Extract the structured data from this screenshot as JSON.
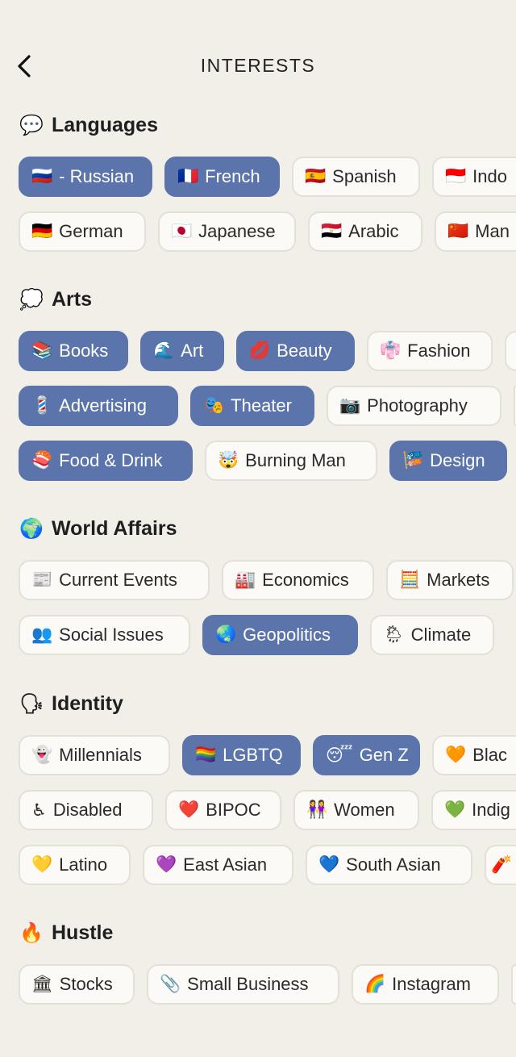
{
  "header": {
    "title": "INTERESTS",
    "back_icon": "chevron-left-icon"
  },
  "colors": {
    "background": "#f1efe8",
    "selected_chip": "#5b74ab",
    "unselected_chip": "#fbfaf6"
  },
  "sections": [
    {
      "emoji": "💬",
      "title": "Languages",
      "rows": [
        [
          {
            "emoji": "🇷🇺",
            "label": "- Russian",
            "selected": true
          },
          {
            "emoji": "🇫🇷",
            "label": "French",
            "selected": true
          },
          {
            "emoji": "🇪🇸",
            "label": "Spanish",
            "selected": false
          },
          {
            "emoji": "🇮🇩",
            "label": "Indo",
            "selected": false
          }
        ],
        [
          {
            "emoji": "🇩🇪",
            "label": "German",
            "selected": false
          },
          {
            "emoji": "🇯🇵",
            "label": "Japanese",
            "selected": false
          },
          {
            "emoji": "🇪🇬",
            "label": "Arabic",
            "selected": false
          },
          {
            "emoji": "🇨🇳",
            "label": "Man",
            "selected": false
          }
        ]
      ]
    },
    {
      "emoji": "💭",
      "title": "Arts",
      "rows": [
        [
          {
            "emoji": "📚",
            "label": "Books",
            "selected": true
          },
          {
            "emoji": "🌊",
            "label": "Art",
            "selected": true
          },
          {
            "emoji": "💋",
            "label": "Beauty",
            "selected": true
          },
          {
            "emoji": "👘",
            "label": "Fashion",
            "selected": false
          },
          {
            "emoji": "",
            "label": "",
            "selected": false
          }
        ],
        [
          {
            "emoji": "💈",
            "label": "Advertising",
            "selected": true
          },
          {
            "emoji": "🎭",
            "label": "Theater",
            "selected": true
          },
          {
            "emoji": "📷",
            "label": "Photography",
            "selected": false
          },
          {
            "emoji": "",
            "label": "",
            "selected": false
          }
        ],
        [
          {
            "emoji": "🍣",
            "label": "Food & Drink",
            "selected": true
          },
          {
            "emoji": "🤯",
            "label": "Burning Man",
            "selected": false
          },
          {
            "emoji": "🎏",
            "label": "Design",
            "selected": true
          }
        ]
      ]
    },
    {
      "emoji": "🌍",
      "title": "World Affairs",
      "rows": [
        [
          {
            "emoji": "📰",
            "label": "Current Events",
            "selected": false
          },
          {
            "emoji": "🏭",
            "label": "Economics",
            "selected": false
          },
          {
            "emoji": "🧮",
            "label": "Markets",
            "selected": false
          }
        ],
        [
          {
            "emoji": "👥",
            "label": "Social Issues",
            "selected": false
          },
          {
            "emoji": "🌏",
            "label": "Geopolitics",
            "selected": true
          },
          {
            "emoji": "🌦",
            "label": "Climate",
            "selected": false
          }
        ]
      ]
    },
    {
      "emoji": "🗣",
      "title": "Identity",
      "rows": [
        [
          {
            "emoji": "👻",
            "label": "Millennials",
            "selected": false
          },
          {
            "emoji": "🏳️‍🌈",
            "label": "LGBTQ",
            "selected": true
          },
          {
            "emoji": "😴",
            "label": "Gen Z",
            "selected": true
          },
          {
            "emoji": "🧡",
            "label": "Blac",
            "selected": false
          }
        ],
        [
          {
            "emoji": "♿",
            "label": "Disabled",
            "selected": false
          },
          {
            "emoji": "❤️",
            "label": "BIPOC",
            "selected": false
          },
          {
            "emoji": "👭",
            "label": "Women",
            "selected": false
          },
          {
            "emoji": "💚",
            "label": "Indig",
            "selected": false
          }
        ],
        [
          {
            "emoji": "💛",
            "label": "Latino",
            "selected": false
          },
          {
            "emoji": "💜",
            "label": "East Asian",
            "selected": false
          },
          {
            "emoji": "💙",
            "label": "South Asian",
            "selected": false
          },
          {
            "emoji": "🧨",
            "label": "",
            "selected": false
          }
        ]
      ]
    },
    {
      "emoji": "🔥",
      "title": "Hustle",
      "rows": [
        [
          {
            "emoji": "🏛",
            "label": "Stocks",
            "selected": false
          },
          {
            "emoji": "📎",
            "label": "Small Business",
            "selected": false
          },
          {
            "emoji": "🌈",
            "label": "Instagram",
            "selected": false
          },
          {
            "emoji": "",
            "label": "",
            "selected": false
          }
        ]
      ]
    }
  ]
}
